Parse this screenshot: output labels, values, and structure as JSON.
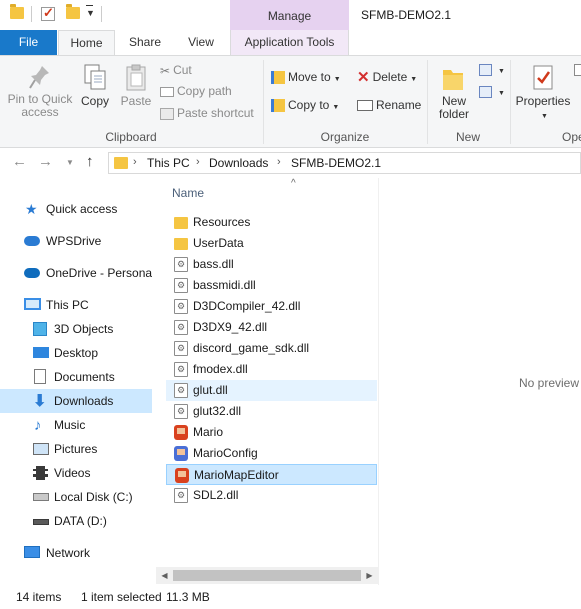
{
  "window": {
    "title": "SFMB-DEMO2.1",
    "manage_label": "Manage"
  },
  "tabs": {
    "file": "File",
    "home": "Home",
    "share": "Share",
    "view": "View",
    "app_tools": "Application Tools"
  },
  "ribbon": {
    "clipboard": {
      "label": "Clipboard",
      "pin": "Pin to Quick access",
      "copy": "Copy",
      "paste": "Paste",
      "cut": "Cut",
      "copy_path": "Copy path",
      "paste_shortcut": "Paste shortcut"
    },
    "organize": {
      "label": "Organize",
      "move_to": "Move to",
      "copy_to": "Copy to",
      "delete": "Delete",
      "rename": "Rename"
    },
    "new": {
      "label": "New",
      "new_folder": "New folder"
    },
    "open": {
      "label": "Ope",
      "properties": "Properties"
    }
  },
  "address": {
    "crumbs": [
      "This PC",
      "Downloads",
      "SFMB-DEMO2.1"
    ]
  },
  "nav": {
    "quick_access": "Quick access",
    "wpsdrive": "WPSDrive",
    "onedrive": "OneDrive - Personal",
    "this_pc": "This PC",
    "objects3d": "3D Objects",
    "desktop": "Desktop",
    "documents": "Documents",
    "downloads": "Downloads",
    "music": "Music",
    "pictures": "Pictures",
    "videos": "Videos",
    "local_disk": "Local Disk (C:)",
    "data_disk": "DATA (D:)",
    "network": "Network"
  },
  "files": {
    "column_name": "Name",
    "items": [
      {
        "name": "Resources",
        "type": "folder"
      },
      {
        "name": "UserData",
        "type": "folder"
      },
      {
        "name": "bass.dll",
        "type": "dll"
      },
      {
        "name": "bassmidi.dll",
        "type": "dll"
      },
      {
        "name": "D3DCompiler_42.dll",
        "type": "dll"
      },
      {
        "name": "D3DX9_42.dll",
        "type": "dll"
      },
      {
        "name": "discord_game_sdk.dll",
        "type": "dll"
      },
      {
        "name": "fmodex.dll",
        "type": "dll"
      },
      {
        "name": "glut.dll",
        "type": "dll"
      },
      {
        "name": "glut32.dll",
        "type": "dll"
      },
      {
        "name": "Mario",
        "type": "exe"
      },
      {
        "name": "MarioConfig",
        "type": "exe"
      },
      {
        "name": "MarioMapEditor",
        "type": "exe"
      },
      {
        "name": "SDL2.dll",
        "type": "dll"
      }
    ]
  },
  "preview": {
    "text": "No preview"
  },
  "status": {
    "count": "14 items",
    "selected": "1 item selected",
    "size": "11.3 MB"
  }
}
